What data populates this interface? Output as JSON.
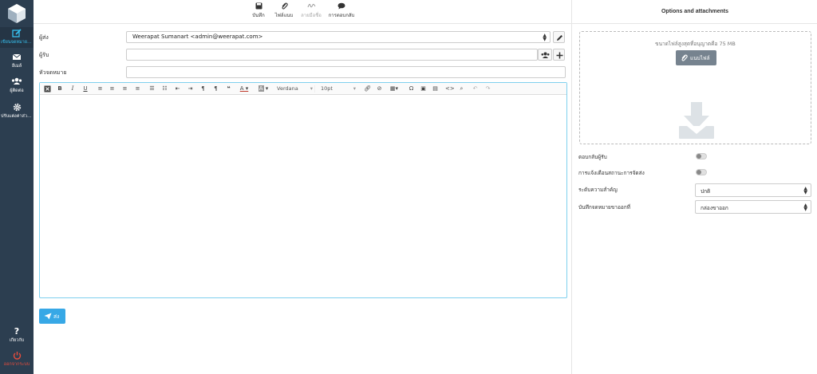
{
  "sidebar": {
    "items": [
      {
        "label": "เขียนจดหมายใหม่",
        "icon": "compose-icon"
      },
      {
        "label": "อีเมล์",
        "icon": "envelope-icon"
      },
      {
        "label": "ผู้ติดต่อ",
        "icon": "contacts-icon"
      },
      {
        "label": "ปรับแต่งค่าส่วนตัว",
        "icon": "gear-icon"
      }
    ],
    "about_label": "เกี่ยวกับ",
    "logout_label": "ออกจากระบบ"
  },
  "toolbar": {
    "save_label": "บันทึก",
    "attach_label": "ไฟล์แนบ",
    "signature_label": "ลายมือชื่อ",
    "responses_label": "การตอบกลับ"
  },
  "compose": {
    "from_label": "ผู้ส่ง",
    "from_value": "Weerapat Sumanart <admin@weerapat.com>",
    "to_label": "ผู้รับ",
    "to_value": "",
    "subject_label": "หัวจดหมาย",
    "subject_value": "",
    "font_family": "Verdana",
    "font_size": "10pt",
    "send_label": "ส่ง"
  },
  "options": {
    "header": "Options and attachments",
    "max_size_text": "ขนาดไฟล์สูงสุดที่อนุญาตคือ 75 MB",
    "attach_button_label": "แนบไฟล์",
    "return_receipt_label": "ตอบกลับผู้รับ",
    "dsn_label": "การแจ้งเตือนสถานะการจัดส่ง",
    "priority_label": "ระดับความสำคัญ",
    "priority_value": "ปกติ",
    "save_sent_label": "บันทึกจดหมายขาออกที่",
    "save_sent_value": "กล่องขาออก"
  },
  "colors": {
    "sidebar": "#2c3e50",
    "accent": "#37a8e6",
    "active_text": "#37c1f0",
    "logout": "#e74c3c"
  }
}
